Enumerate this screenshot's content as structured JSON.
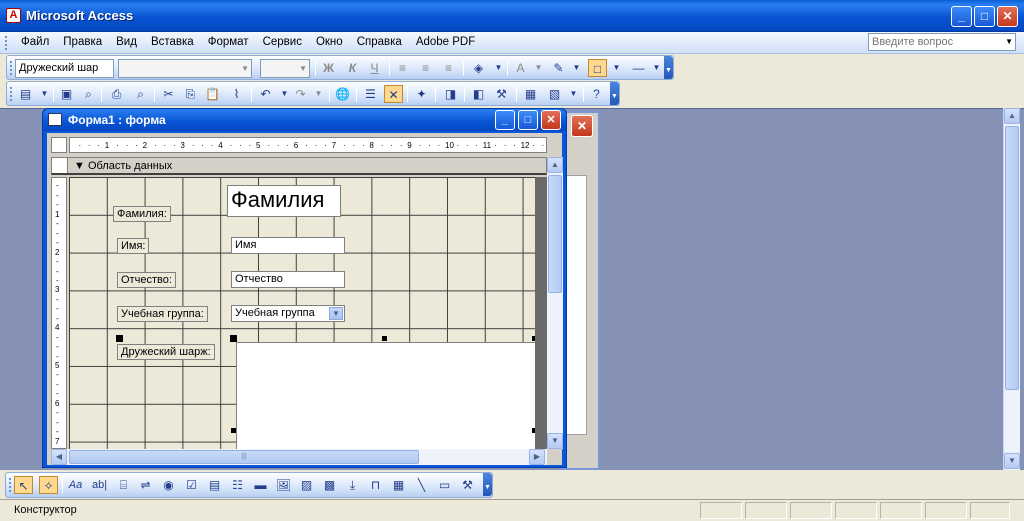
{
  "app": {
    "title": "Microsoft Access",
    "icon_letter": "A"
  },
  "menu": {
    "items": [
      "Файл",
      "Правка",
      "Вид",
      "Вставка",
      "Формат",
      "Сервис",
      "Окно",
      "Справка",
      "Adobe PDF"
    ],
    "help_placeholder": "Введите вопрос"
  },
  "format_toolbar": {
    "object_combo": "Дружеский шар",
    "bold": "Ж",
    "italic": "К",
    "underline": "Ч"
  },
  "form_window": {
    "title": "Форма1 : форма",
    "section_label": "Область данных",
    "ruler_h": [
      "1",
      "2",
      "3",
      "4",
      "5",
      "6",
      "7",
      "8",
      "9",
      "10",
      "11",
      "12"
    ],
    "ruler_v": [
      "1",
      "2",
      "3",
      "4",
      "5",
      "6",
      "7"
    ],
    "labels": {
      "surname": "Фамилия:",
      "name": "Имя:",
      "patronymic": "Отчество:",
      "group": "Учебная группа:",
      "caricature": "Дружеский шарж:"
    },
    "controls": {
      "surname": "Фамилия",
      "name": "Имя",
      "patronymic": "Отчество",
      "group": "Учебная группа"
    }
  },
  "toolbox": {
    "tools": [
      "select-pointer",
      "wizard",
      "label",
      "textbox",
      "option-group",
      "toggle",
      "option",
      "checkbox",
      "combobox",
      "listbox",
      "command",
      "image",
      "unbound-frame",
      "bound-frame",
      "page-break",
      "tab-control",
      "subform",
      "line",
      "rectangle",
      "more-controls"
    ],
    "label_glyph": "Аа",
    "textbox_glyph": "ab|"
  },
  "status": {
    "text": "Конструктор"
  },
  "colors": {
    "title_blue": "#0854d4",
    "workspace": "#8592b5",
    "grid_bg": "#ece9d8"
  }
}
